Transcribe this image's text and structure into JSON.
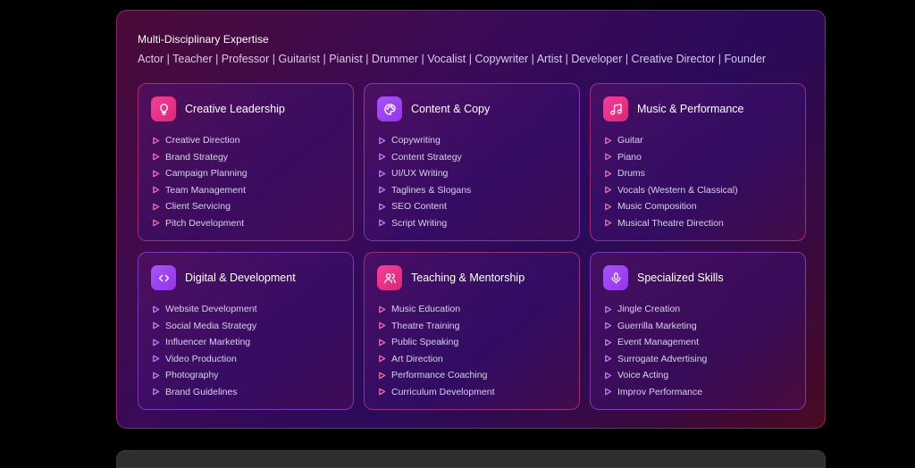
{
  "section": {
    "heading": "Multi-Disciplinary Expertise",
    "roles": "Actor | Teacher | Professor | Guitarist | Pianist | Drummer | Vocalist | Copywriter | Artist | Developer | Creative Director | Founder"
  },
  "colors": {
    "pink": "#ec4899",
    "purple": "#a855f7"
  },
  "cards": [
    {
      "title": "Creative Leadership",
      "icon": "lightbulb-icon",
      "items": [
        "Creative Direction",
        "Brand Strategy",
        "Campaign Planning",
        "Team Management",
        "Client Servicing",
        "Pitch Development"
      ]
    },
    {
      "title": "Content & Copy",
      "icon": "palette-icon",
      "items": [
        "Copywriting",
        "Content Strategy",
        "UI/UX Writing",
        "Taglines & Slogans",
        "SEO Content",
        "Script Writing"
      ]
    },
    {
      "title": "Music & Performance",
      "icon": "music-note-icon",
      "items": [
        "Guitar",
        "Piano",
        "Drums",
        "Vocals (Western & Classical)",
        "Music Composition",
        "Musical Theatre Direction"
      ]
    },
    {
      "title": "Digital & Development",
      "icon": "code-icon",
      "items": [
        "Website Development",
        "Social Media Strategy",
        "Influencer Marketing",
        "Video Production",
        "Photography",
        "Brand Guidelines"
      ]
    },
    {
      "title": "Teaching & Mentorship",
      "icon": "users-icon",
      "items": [
        "Music Education",
        "Theatre Training",
        "Public Speaking",
        "Art Direction",
        "Performance Coaching",
        "Curriculum Development"
      ]
    },
    {
      "title": "Specialized Skills",
      "icon": "microphone-icon",
      "items": [
        "Jingle Creation",
        "Guerrilla Marketing",
        "Event Management",
        "Surrogate Advertising",
        "Voice Acting",
        "Improv Performance"
      ]
    }
  ]
}
